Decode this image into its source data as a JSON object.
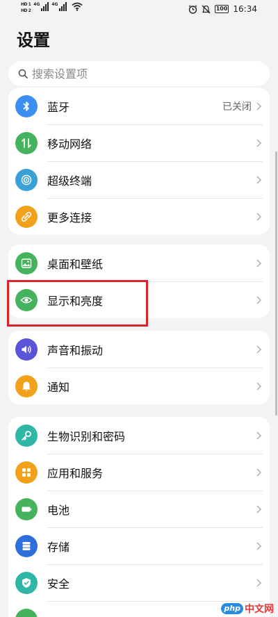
{
  "status_bar": {
    "sim1": "HD 1",
    "sim2": "HD 2",
    "net1": "4G",
    "net2": "4G",
    "battery": "100",
    "time": "16:34"
  },
  "page_title": "设置",
  "search": {
    "placeholder": "搜索设置项",
    "icon": "search-icon"
  },
  "groups": [
    {
      "items": [
        {
          "icon": "bluetooth-icon",
          "color": "#3d8ef0",
          "label": "蓝牙",
          "value": "已关闭"
        },
        {
          "icon": "mobile-network-icon",
          "color": "#45b35e",
          "label": "移动网络"
        },
        {
          "icon": "super-device-icon",
          "color": "#3aa0d8",
          "label": "超级终端"
        },
        {
          "icon": "link-icon",
          "color": "#f2a11b",
          "label": "更多连接"
        }
      ]
    },
    {
      "items": [
        {
          "icon": "wallpaper-icon",
          "color": "#45b35e",
          "label": "桌面和壁纸"
        },
        {
          "icon": "eye-icon",
          "color": "#45b35e",
          "label": "显示和亮度"
        }
      ]
    },
    {
      "items": [
        {
          "icon": "speaker-icon",
          "color": "#5a55d8",
          "label": "声音和振动"
        },
        {
          "icon": "bell-icon",
          "color": "#f2a11b",
          "label": "通知"
        }
      ]
    },
    {
      "items": [
        {
          "icon": "key-icon",
          "color": "#2fb6a6",
          "label": "生物识别和密码"
        },
        {
          "icon": "apps-icon",
          "color": "#f2a11b",
          "label": "应用和服务"
        },
        {
          "icon": "battery-icon",
          "color": "#45b35e",
          "label": "电池"
        },
        {
          "icon": "storage-icon",
          "color": "#2d6fdc",
          "label": "存储"
        },
        {
          "icon": "shield-icon",
          "color": "#2fb6a6",
          "label": "安全"
        }
      ]
    }
  ],
  "highlight_color": "#d9252a",
  "watermark": {
    "logo": "php",
    "text": "中文网"
  }
}
